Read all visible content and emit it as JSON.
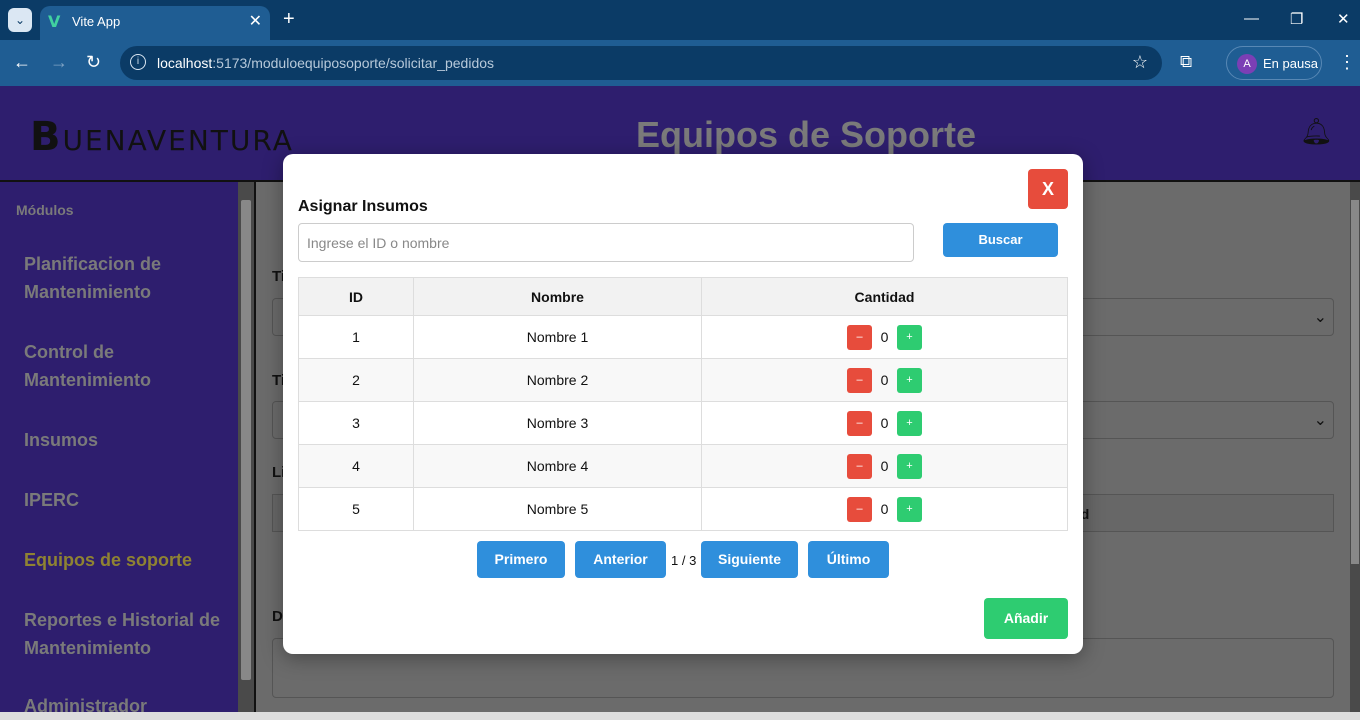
{
  "browser": {
    "tab_title": "Vite App",
    "favicon": "V",
    "url_host": "localhost",
    "url_rest": ":5173/moduloequiposoporte/solicitar_pedidos",
    "profile_initial": "A",
    "profile_status": "En pausa"
  },
  "header": {
    "logo_first": "B",
    "logo_rest": "UENAVENTURA",
    "title": "Equipos de Soporte"
  },
  "sidebar": {
    "heading": "Módulos",
    "items": [
      {
        "label": "Planificacion de Mantenimiento"
      },
      {
        "label": "Control de Mantenimiento"
      },
      {
        "label": "Insumos"
      },
      {
        "label": "IPERC"
      },
      {
        "label": "Equipos de soporte"
      },
      {
        "label": "Reportes e Historial de Mantenimiento"
      },
      {
        "label": "Administrador"
      }
    ],
    "active_index": 4
  },
  "background": {
    "label1": "Ti",
    "label2": "Ti",
    "label3": "Li",
    "label4": "D",
    "table_header_fragment": "ad"
  },
  "modal": {
    "close_label": "X",
    "title": "Asignar Insumos",
    "search_placeholder": "Ingrese el ID o nombre",
    "search_button": "Buscar",
    "columns": [
      "ID",
      "Nombre",
      "Cantidad"
    ],
    "rows": [
      {
        "id": "1",
        "name": "Nombre 1",
        "qty": "0"
      },
      {
        "id": "2",
        "name": "Nombre 2",
        "qty": "0"
      },
      {
        "id": "3",
        "name": "Nombre 3",
        "qty": "0"
      },
      {
        "id": "4",
        "name": "Nombre 4",
        "qty": "0"
      },
      {
        "id": "5",
        "name": "Nombre 5",
        "qty": "0"
      }
    ],
    "minus_label": "–",
    "plus_label": "+",
    "pagination": {
      "first": "Primero",
      "prev": "Anterior",
      "info": "1 / 3",
      "next": "Siguiente",
      "last": "Último"
    },
    "add_button": "Añadir"
  }
}
